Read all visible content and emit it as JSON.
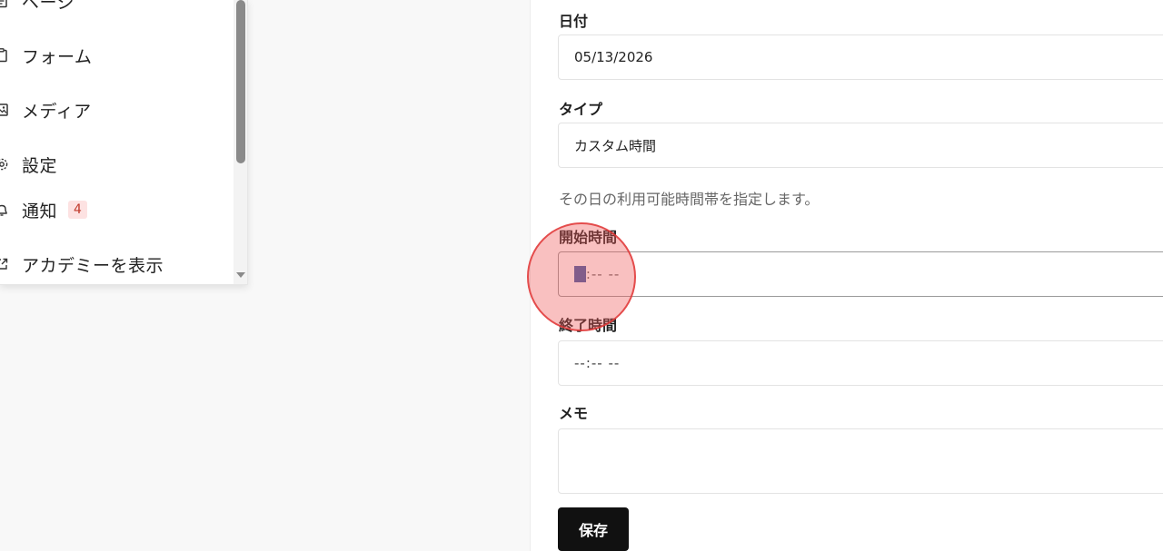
{
  "sidebar": {
    "items": [
      {
        "label": "ページ",
        "icon": "page-icon"
      },
      {
        "label": "フォーム",
        "icon": "form-icon"
      },
      {
        "label": "メディア",
        "icon": "image-icon"
      },
      {
        "label": "設定",
        "icon": "gear-icon"
      },
      {
        "label": "通知",
        "icon": "bell-icon",
        "badge": "4"
      },
      {
        "label": "アカデミーを表示",
        "icon": "external-link-icon"
      }
    ]
  },
  "form": {
    "date_label": "日付",
    "date_value": "05/13/2026",
    "type_label": "タイプ",
    "type_value": "カスタム時間",
    "help_text": "その日の利用可能時間帯を指定します。",
    "start_label": "開始時間",
    "start_value_selected": "--",
    "start_value_rest": ":-- --",
    "end_label": "終了時間",
    "end_value": "--:-- --",
    "memo_label": "メモ",
    "memo_value": "",
    "save_label": "保存"
  },
  "colors": {
    "selection": "#3f5ea8",
    "badge_bg": "#fde2e2",
    "badge_text": "#c0392b",
    "button_bg": "#111111"
  }
}
